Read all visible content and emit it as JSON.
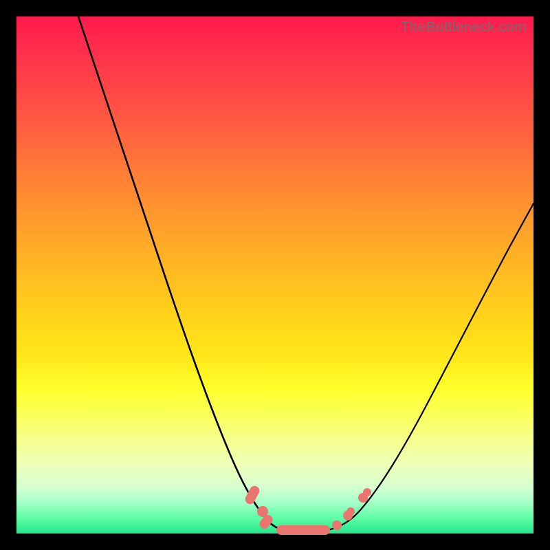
{
  "watermark": "TheBottleneck.com",
  "colors": {
    "background": "#000000",
    "gradient_top": "#ff1a4d",
    "gradient_bottom": "#23e78b",
    "curve": "#000000",
    "markers": "#e8766e",
    "watermark_text": "#6f6f6f"
  },
  "chart_data": {
    "type": "line",
    "title": "",
    "xlabel": "",
    "ylabel": "",
    "xlim": [
      0,
      100
    ],
    "ylim": [
      0,
      100
    ],
    "grid": false,
    "series": [
      {
        "name": "left-curve",
        "x": [
          12,
          16,
          20,
          24,
          28,
          32,
          36,
          40,
          44,
          46,
          48,
          50
        ],
        "y": [
          100,
          88,
          76,
          64,
          52,
          40,
          28,
          17,
          8,
          4.5,
          2,
          0.7
        ]
      },
      {
        "name": "right-curve",
        "x": [
          60,
          63,
          66,
          70,
          74,
          78,
          82,
          86,
          90,
          94,
          98,
          100
        ],
        "y": [
          0.7,
          2,
          5,
          10,
          17,
          25,
          33,
          41,
          49,
          56,
          62,
          65
        ]
      },
      {
        "name": "flat-bottom",
        "x": [
          50,
          60
        ],
        "y": [
          0.7,
          0.7
        ]
      }
    ],
    "annotations": [
      {
        "type": "marker-cluster",
        "description": "salmon markers near minimum",
        "approx_x_range": [
          46,
          65
        ],
        "approx_y_range": [
          0.5,
          8
        ]
      }
    ]
  }
}
